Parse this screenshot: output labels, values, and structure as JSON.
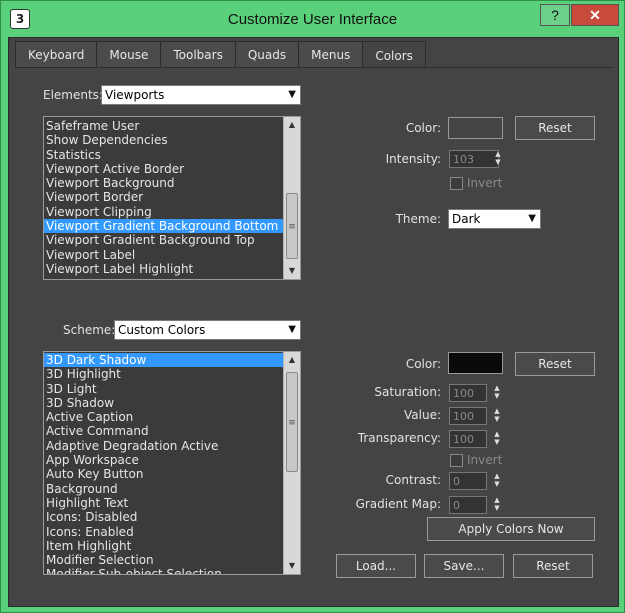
{
  "window": {
    "title": "Customize User Interface",
    "app_icon": "3",
    "help_label": "?",
    "close_label": "✕"
  },
  "tabs": [
    {
      "label": "Keyboard"
    },
    {
      "label": "Mouse"
    },
    {
      "label": "Toolbars"
    },
    {
      "label": "Quads"
    },
    {
      "label": "Menus"
    },
    {
      "label": "Colors"
    }
  ],
  "elements": {
    "label": "Elements:",
    "selected": "Viewports",
    "items": [
      "Safeframe User",
      "Show Dependencies",
      "Statistics",
      "Viewport Active Border",
      "Viewport Background",
      "Viewport Border",
      "Viewport Clipping",
      "Viewport Gradient Background Bottom",
      "Viewport Gradient Background Top",
      "Viewport Label",
      "Viewport Label Highlight"
    ],
    "selected_item": "Viewport Gradient Background Bottom"
  },
  "element_props": {
    "color_label": "Color:",
    "reset_label": "Reset",
    "intensity_label": "Intensity:",
    "intensity_value": "103",
    "invert_label": "Invert",
    "theme_label": "Theme:",
    "theme_value": "Dark",
    "swatch_color": "#444444"
  },
  "scheme": {
    "label": "Scheme:",
    "selected": "Custom Colors",
    "items": [
      "3D Dark Shadow",
      "3D Highlight",
      "3D Light",
      "3D Shadow",
      "Active Caption",
      "Active Command",
      "Adaptive Degradation Active",
      "App Workspace",
      "Auto Key Button",
      "Background",
      "Highlight Text",
      "Icons: Disabled",
      "Icons: Enabled",
      "Item Highlight",
      "Modifier Selection",
      "Modifier Sub-object Selection"
    ],
    "selected_item": "3D Dark Shadow"
  },
  "scheme_props": {
    "color_label": "Color:",
    "reset_label": "Reset",
    "saturation_label": "Saturation:",
    "saturation_value": "100",
    "value_label": "Value:",
    "value_value": "100",
    "transparency_label": "Transparency:",
    "transparency_value": "100",
    "invert_label": "Invert",
    "contrast_label": "Contrast:",
    "contrast_value": "0",
    "gradient_label": "Gradient Map:",
    "gradient_value": "0",
    "apply_label": "Apply Colors Now",
    "swatch_color": "#0a0a0a"
  },
  "footer": {
    "load_label": "Load...",
    "save_label": "Save...",
    "reset_label": "Reset"
  },
  "colors": {
    "titlebar": "#5ad07a",
    "panel": "#444444",
    "selection": "#3399ff",
    "close": "#c74a3a"
  }
}
